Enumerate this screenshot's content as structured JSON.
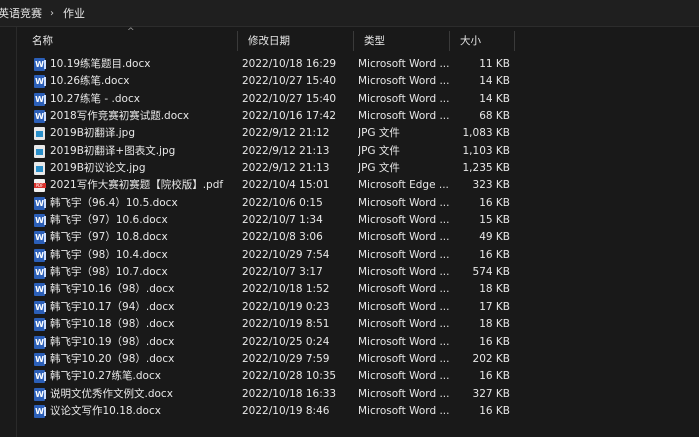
{
  "breadcrumb": {
    "items": [
      "英语竞赛",
      "作业"
    ],
    "separator": "›"
  },
  "columns": {
    "name": "名称",
    "date": "修改日期",
    "type": "类型",
    "size": "大小"
  },
  "sort_indicator": "^",
  "files": [
    {
      "name": "10.19练笔题目.docx",
      "date": "2022/10/18 16:29",
      "type": "Microsoft Word ...",
      "size": "11 KB",
      "icon": "word-icon"
    },
    {
      "name": "10.26练笔.docx",
      "date": "2022/10/27 15:40",
      "type": "Microsoft Word ...",
      "size": "14 KB",
      "icon": "word-icon"
    },
    {
      "name": "10.27练笔 - .docx",
      "date": "2022/10/27 15:40",
      "type": "Microsoft Word ...",
      "size": "14 KB",
      "icon": "word-icon"
    },
    {
      "name": "2018写作竞赛初赛试题.docx",
      "date": "2022/10/16 17:42",
      "type": "Microsoft Word ...",
      "size": "68 KB",
      "icon": "word-icon"
    },
    {
      "name": "2019B初翻译.jpg",
      "date": "2022/9/12 21:12",
      "type": "JPG 文件",
      "size": "1,083 KB",
      "icon": "jpg-icon"
    },
    {
      "name": "2019B初翻译+图表文.jpg",
      "date": "2022/9/12 21:13",
      "type": "JPG 文件",
      "size": "1,103 KB",
      "icon": "jpg-icon"
    },
    {
      "name": "2019B初议论文.jpg",
      "date": "2022/9/12 21:13",
      "type": "JPG 文件",
      "size": "1,235 KB",
      "icon": "jpg-icon"
    },
    {
      "name": "2021写作大赛初赛题【院校版】.pdf",
      "date": "2022/10/4 15:01",
      "type": "Microsoft Edge ...",
      "size": "323 KB",
      "icon": "pdf-icon"
    },
    {
      "name": "韩飞宇（96.4）10.5.docx",
      "date": "2022/10/6 0:15",
      "type": "Microsoft Word ...",
      "size": "16 KB",
      "icon": "word-icon"
    },
    {
      "name": "韩飞宇（97）10.6.docx",
      "date": "2022/10/7 1:34",
      "type": "Microsoft Word ...",
      "size": "15 KB",
      "icon": "word-icon"
    },
    {
      "name": "韩飞宇（97）10.8.docx",
      "date": "2022/10/8 3:06",
      "type": "Microsoft Word ...",
      "size": "49 KB",
      "icon": "word-icon"
    },
    {
      "name": "韩飞宇（98）10.4.docx",
      "date": "2022/10/29 7:54",
      "type": "Microsoft Word ...",
      "size": "16 KB",
      "icon": "word-icon"
    },
    {
      "name": "韩飞宇（98）10.7.docx",
      "date": "2022/10/7 3:17",
      "type": "Microsoft Word ...",
      "size": "574 KB",
      "icon": "word-icon"
    },
    {
      "name": "韩飞宇10.16（98）.docx",
      "date": "2022/10/18 1:52",
      "type": "Microsoft Word ...",
      "size": "18 KB",
      "icon": "word-icon"
    },
    {
      "name": "韩飞宇10.17（94）.docx",
      "date": "2022/10/19 0:23",
      "type": "Microsoft Word ...",
      "size": "17 KB",
      "icon": "word-icon"
    },
    {
      "name": "韩飞宇10.18（98）.docx",
      "date": "2022/10/19 8:51",
      "type": "Microsoft Word ...",
      "size": "18 KB",
      "icon": "word-icon"
    },
    {
      "name": "韩飞宇10.19（98）.docx",
      "date": "2022/10/25 0:24",
      "type": "Microsoft Word ...",
      "size": "16 KB",
      "icon": "word-icon"
    },
    {
      "name": "韩飞宇10.20（98）.docx",
      "date": "2022/10/29 7:59",
      "type": "Microsoft Word ...",
      "size": "202 KB",
      "icon": "word-icon"
    },
    {
      "name": "韩飞宇10.27练笔.docx",
      "date": "2022/10/28 10:35",
      "type": "Microsoft Word ...",
      "size": "16 KB",
      "icon": "word-icon"
    },
    {
      "name": "说明文优秀作文例文.docx",
      "date": "2022/10/18 16:33",
      "type": "Microsoft Word ...",
      "size": "327 KB",
      "icon": "word-icon"
    },
    {
      "name": "议论文写作10.18.docx",
      "date": "2022/10/19 8:46",
      "type": "Microsoft Word ...",
      "size": "16 KB",
      "icon": "word-icon"
    }
  ]
}
